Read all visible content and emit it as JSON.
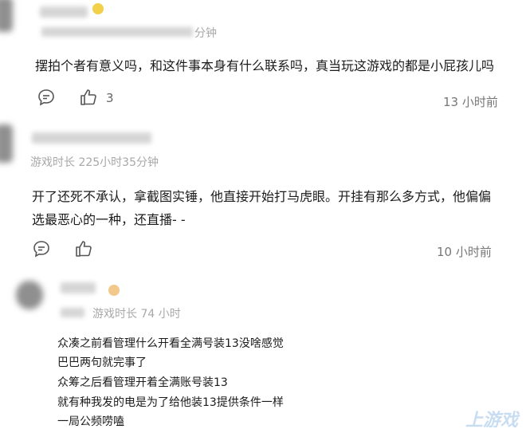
{
  "comments": [
    {
      "meta_suffix": "分钟",
      "text": "摆拍个者有意义吗，和这件事本身有什么联系吗，真当玩这游戏的都是小屁孩儿吗",
      "likes": "3",
      "time": "13 小时前"
    },
    {
      "meta": "游戏时长 225小时35分钟",
      "text_line1": "开了还死不承认，拿截图实锤，他直接开始打马虎眼。开挂有那么多方式，他偏偏",
      "text_line2": "选最恶心的一种，还直播- -",
      "time": "10 小时前"
    },
    {
      "meta": "游戏时长 74 小时",
      "lines": [
        "众凑之前看管理什么开看全满号装13没啥感觉",
        "巴巴两句就完事了",
        "众筹之后看管理开着全满账号装13",
        "就有种我发的电是为了给他装13提供条件一样",
        "一局公频唠嗑"
      ]
    }
  ],
  "watermark": "上游戏"
}
